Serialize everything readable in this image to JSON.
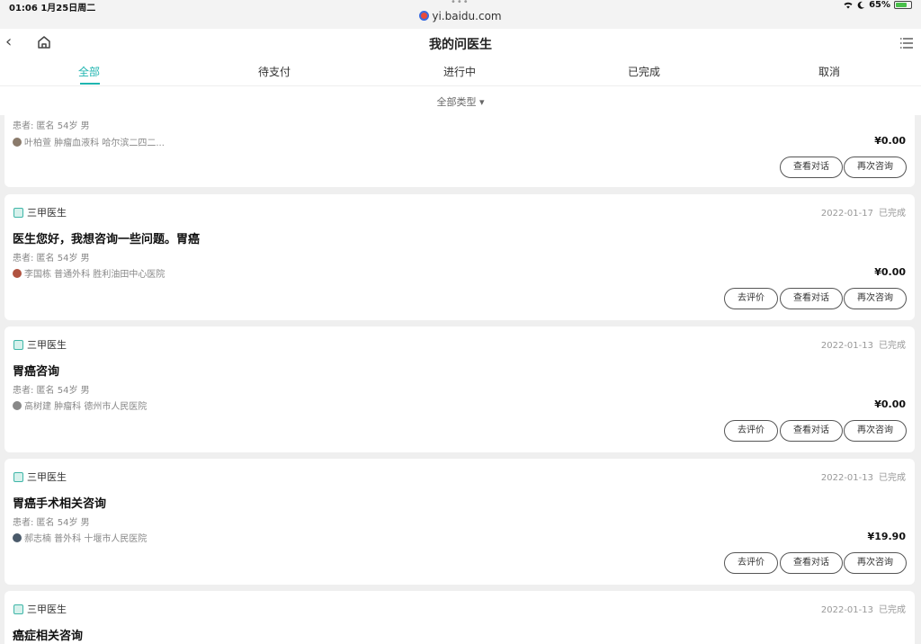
{
  "status_bar": {
    "time": "01:06",
    "date": "1月25日周二",
    "url": "yi.baidu.com",
    "battery": "65%",
    "battery_level": 0.65
  },
  "nav": {
    "title": "我的问医生"
  },
  "tabs": [
    {
      "label": "全部",
      "active": true
    },
    {
      "label": "待支付",
      "active": false
    },
    {
      "label": "进行中",
      "active": false
    },
    {
      "label": "已完成",
      "active": false
    },
    {
      "label": "取消",
      "active": false
    }
  ],
  "filter": {
    "label": "全部类型 ▾"
  },
  "cards": [
    {
      "patient": "患者:  匿名  54岁  男",
      "doctor": "叶柏萱  肿瘤血液科  哈尔滨二四二...",
      "price": "¥0.00",
      "buttons": [
        "查看对话",
        "再次咨询"
      ]
    },
    {
      "tag": "三甲医生",
      "date": "2022-01-17",
      "status": "已完成",
      "title": "医生您好，我想咨询一些问题。胃癌",
      "patient": "患者:  匿名  54岁  男",
      "doctor": "李国栋  普通外科  胜利油田中心医院",
      "price": "¥0.00",
      "buttons": [
        "去评价",
        "查看对话",
        "再次咨询"
      ]
    },
    {
      "tag": "三甲医生",
      "date": "2022-01-13",
      "status": "已完成",
      "title": "胃癌咨询",
      "patient": "患者:  匿名  54岁  男",
      "doctor": "高树建  肿瘤科  德州市人民医院",
      "price": "¥0.00",
      "buttons": [
        "去评价",
        "查看对话",
        "再次咨询"
      ]
    },
    {
      "tag": "三甲医生",
      "date": "2022-01-13",
      "status": "已完成",
      "title": "胃癌手术相关咨询",
      "patient": "患者:  匿名  54岁  男",
      "doctor": "郝志楠  普外科  十堰市人民医院",
      "price": "¥19.90",
      "buttons": [
        "去评价",
        "查看对话",
        "再次咨询"
      ]
    },
    {
      "tag": "三甲医生",
      "date": "2022-01-13",
      "status": "已完成",
      "title": "癌症相关咨询"
    }
  ]
}
